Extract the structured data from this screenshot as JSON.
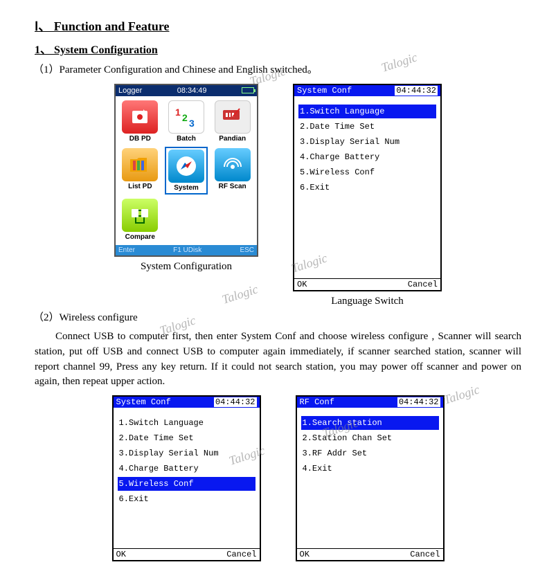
{
  "title": "Ⅰ、 Function and Feature",
  "section1": {
    "heading": "1、 System Configuration",
    "item1": "（1）Parameter Configuration and Chinese and English switched。",
    "item2": "（2）Wireless configure",
    "body2": "Connect USB to computer first, then enter System Conf and choose wireless configure , Scanner will search station, put off USB and connect USB to computer again immediately, if scanner searched station, scanner will report channel 99, Press any key return. If it could not search station, you may power off scanner and power on again, then repeat upper action."
  },
  "home": {
    "logger": "Logger",
    "time": "08:34:49",
    "items": [
      {
        "label": "DB PD"
      },
      {
        "label": "Batch"
      },
      {
        "label": "Pandian"
      },
      {
        "label": "List PD"
      },
      {
        "label": "System"
      },
      {
        "label": "RF Scan"
      },
      {
        "label": "Compare"
      }
    ],
    "foot_left": "Enter",
    "foot_mid": "F1 UDisk",
    "foot_right": "ESC",
    "caption": "System Configuration"
  },
  "sysconf": {
    "title": "System Conf",
    "time": "04:44:32",
    "items": [
      "1.Switch Language",
      "2.Date Time Set",
      "3.Display Serial Num",
      "4.Charge Battery",
      "5.Wireless Conf",
      "6.Exit"
    ],
    "ok": "OK",
    "cancel": "Cancel",
    "caption": "Language Switch"
  },
  "sysconf2": {
    "title": "System Conf",
    "time": "04:44:32",
    "items": [
      "1.Switch Language",
      "2.Date Time Set",
      "3.Display Serial Num",
      "4.Charge Battery",
      "5.Wireless Conf",
      "6.Exit"
    ],
    "ok": "OK",
    "cancel": "Cancel"
  },
  "rfconf": {
    "title": "RF Conf",
    "time": "04:44:32",
    "items": [
      "1.Search station",
      "2.Station Chan Set",
      "3.RF Addr Set",
      "4.Exit"
    ],
    "ok": "OK",
    "cancel": "Cancel"
  },
  "watermark": "Talogic"
}
